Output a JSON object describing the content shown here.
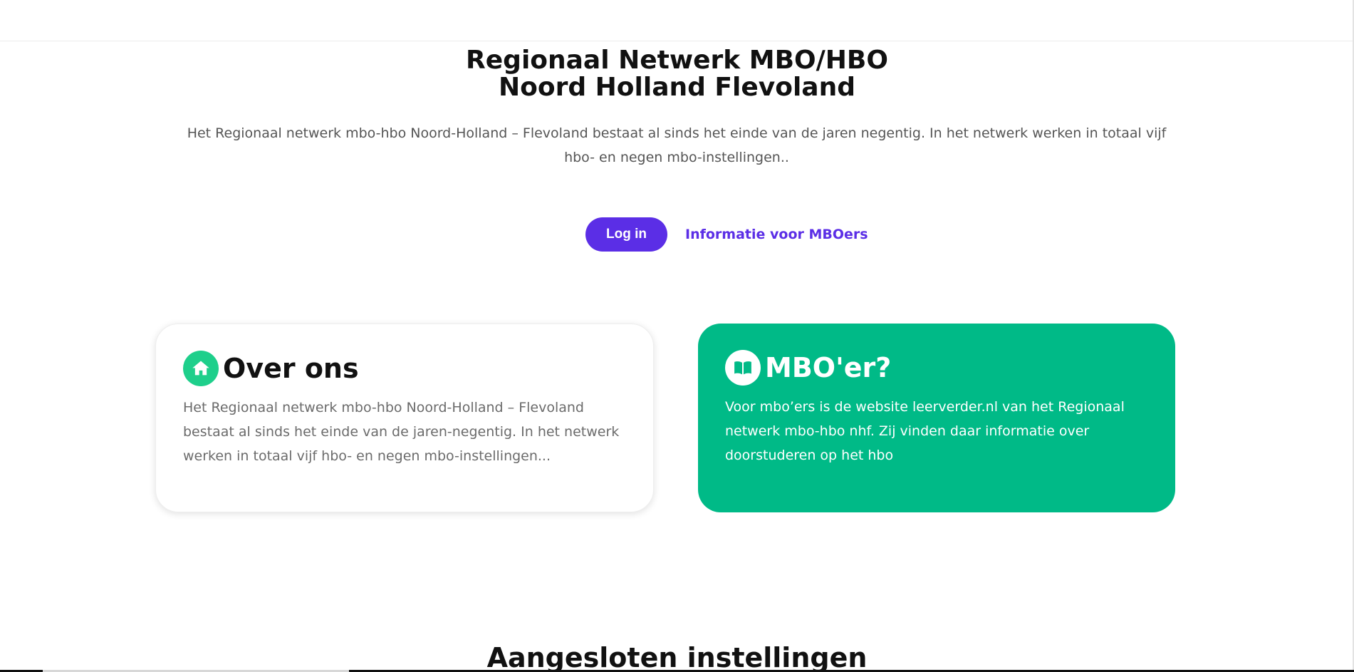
{
  "hero": {
    "title_line1": "Regionaal Netwerk MBO/HBO",
    "title_line2": "Noord Holland Flevoland",
    "intro": "Het Regionaal netwerk mbo-hbo Noord-Holland – Flevoland bestaat al sinds het einde van de jaren negentig. In het netwerk werken in totaal vijf hbo- en negen mbo-instellingen.."
  },
  "cta": {
    "login_label": "Log in",
    "info_link_label": "Informatie voor MBOers"
  },
  "cards": {
    "about": {
      "icon": "home-icon",
      "title": "Over ons",
      "body": "Het Regionaal netwerk mbo-hbo Noord-Holland – Flevoland bestaat al sinds het einde van de jaren-negentig. In het netwerk werken in totaal vijf hbo- en negen mbo-instellingen..."
    },
    "mbo": {
      "icon": "book-icon",
      "title": "MBO'er?",
      "body": "Voor mbo’ers is de website leerverder.nl van het Regionaal netwerk mbo-hbo nhf. Zij vinden daar informatie over doorstuderen op het hbo"
    }
  },
  "sections": {
    "affiliated_title": "Aangesloten instellingen"
  },
  "colors": {
    "accent_purple": "#5b2ee6",
    "green_card": "#00ba87",
    "green_icon": "#1ecf8b"
  }
}
